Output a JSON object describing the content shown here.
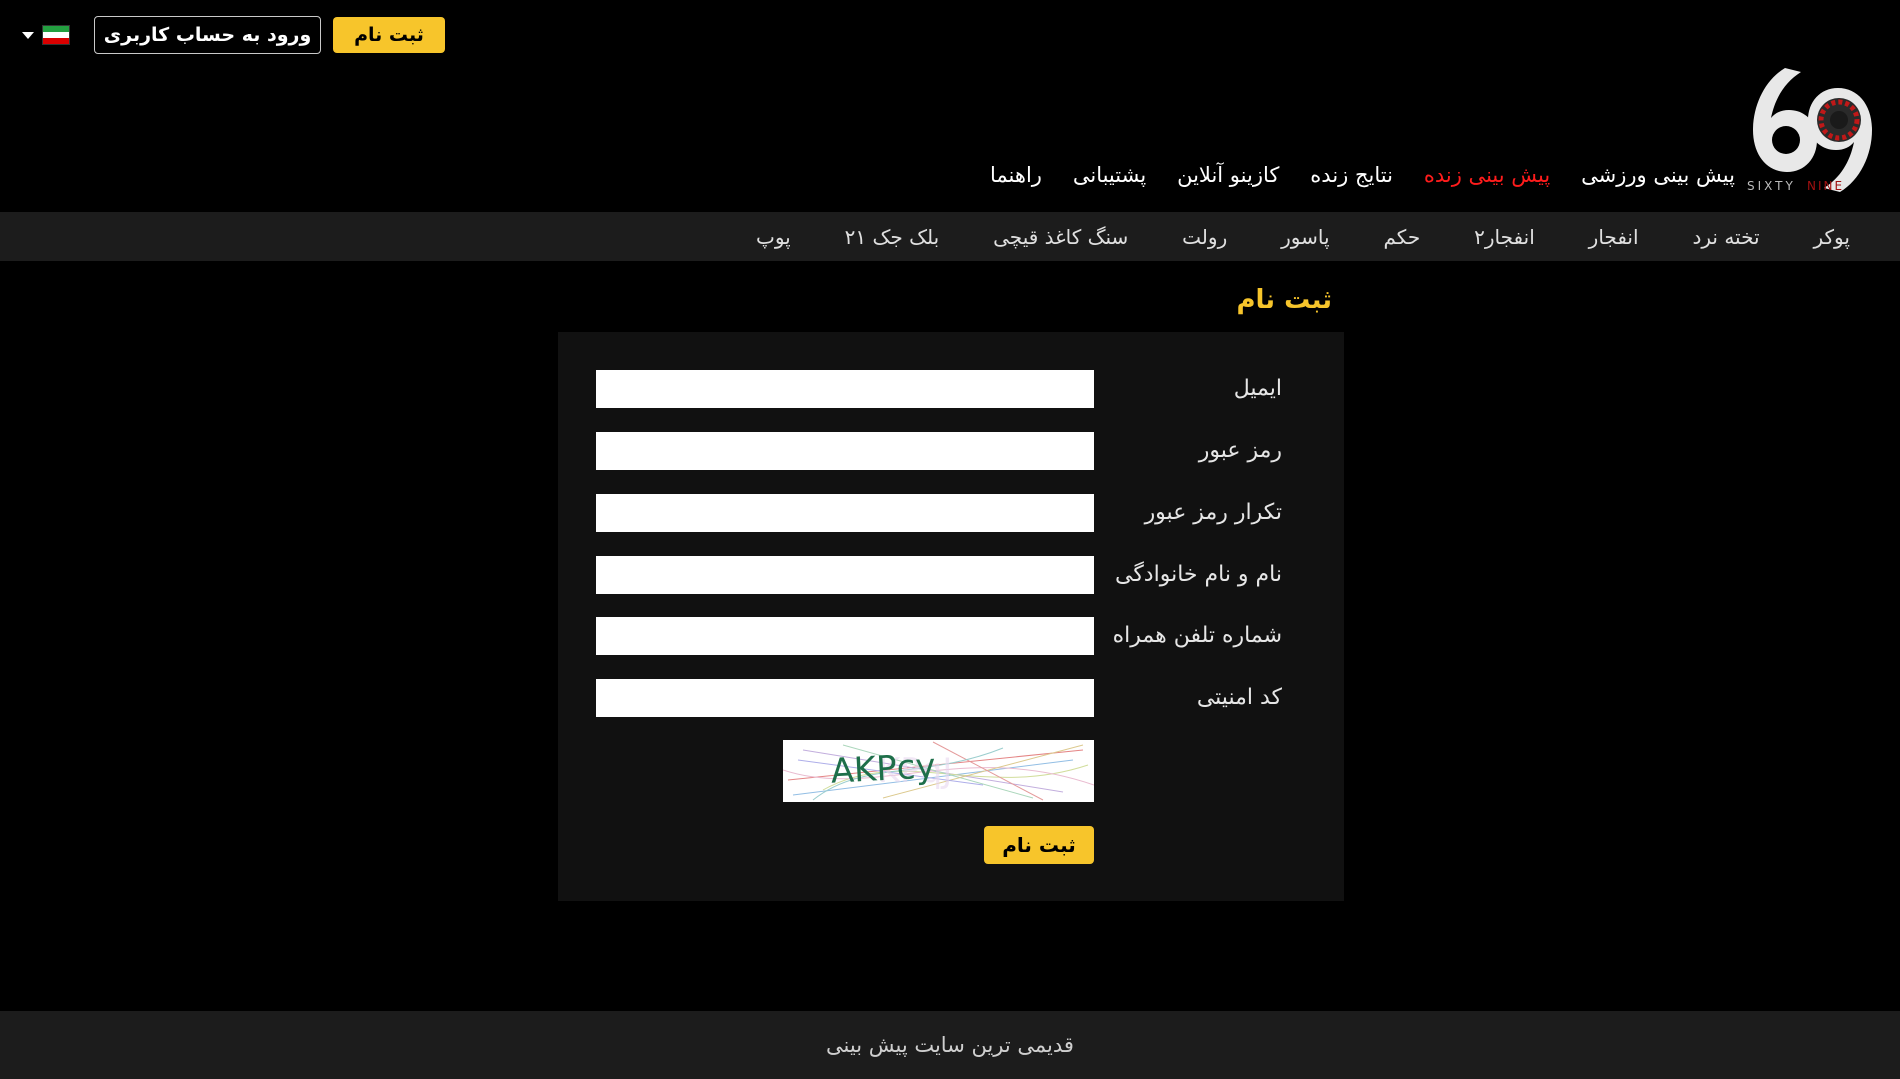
{
  "header": {
    "register_label": "ثبت نام",
    "login_label": "ورود به حساب کاربری",
    "language_flag": "iran-flag-icon",
    "flag_colors": [
      "#239f40",
      "#ffffff",
      "#da0000"
    ]
  },
  "logo": {
    "text": "SIXTY NINE",
    "icon": "roulette-69-logo"
  },
  "main_nav": [
    {
      "label": "پیش بینی ورزشی",
      "active": false
    },
    {
      "label": "پیش بینی زنده",
      "active": true
    },
    {
      "label": "نتایج زنده",
      "active": false
    },
    {
      "label": "کازینو آنلاین",
      "active": false
    },
    {
      "label": "پشتیبانی",
      "active": false
    },
    {
      "label": "راهنما",
      "active": false
    }
  ],
  "game_nav": [
    "پوکر",
    "تخته نرد",
    "انفجار",
    "انفجار۲",
    "حکم",
    "پاسور",
    "رولت",
    "سنگ کاغذ قیچی",
    "بلک جک ۲۱",
    "پوپ"
  ],
  "form": {
    "title": "ثبت نام",
    "fields": [
      {
        "label": "ایمیل",
        "value": "",
        "placeholder": ""
      },
      {
        "label": "رمز عبور",
        "value": "",
        "placeholder": ""
      },
      {
        "label": "تکرار رمز عبور",
        "value": "",
        "placeholder": ""
      },
      {
        "label": "نام و نام خانوادگی",
        "value": "",
        "placeholder": ""
      },
      {
        "label": "شماره تلفن همراه",
        "value": "",
        "placeholder": ""
      },
      {
        "label": "کد امنیتی",
        "value": "",
        "placeholder": ""
      }
    ],
    "captcha_text": "AKPcy",
    "submit_label": "ثبت نام"
  },
  "footer": {
    "text": "قدیمی ترین سایت پیش بینی"
  },
  "colors": {
    "accent": "#f7c52b",
    "active_nav": "#ff1c1c",
    "background": "#000000",
    "panel": "#111111",
    "bar": "#1c1c1c"
  }
}
